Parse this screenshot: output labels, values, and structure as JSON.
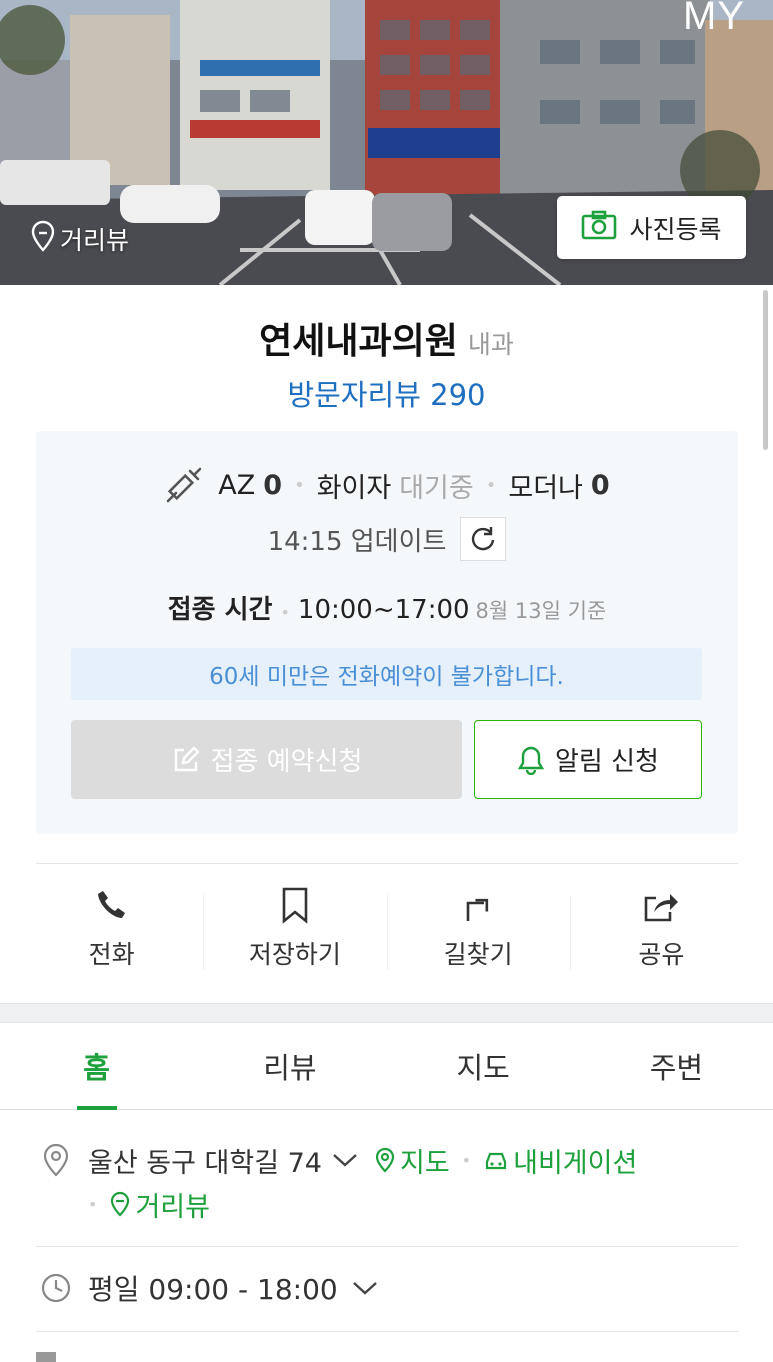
{
  "header": {
    "my_label": "MY",
    "street_view_label": "거리뷰",
    "photo_register_label": "사진등록"
  },
  "place": {
    "name": "연세내과의원",
    "category": "내과",
    "visitor_review": "방문자리뷰 290"
  },
  "vaccine": {
    "az_label": "AZ",
    "az_count": "0",
    "pfizer_label": "화이자",
    "pfizer_status": "대기중",
    "moderna_label": "모더나",
    "moderna_count": "0",
    "update_text": "14:15 업데이트",
    "time_label": "접종 시간",
    "time_value": "10:00~17:00",
    "time_basis": "8월 13일 기준",
    "notice": "60세 미만은 전화예약이 불가합니다.",
    "reserve_button": "접종 예약신청",
    "alarm_button": "알림 신청"
  },
  "actions": [
    {
      "label": "전화",
      "icon": "phone-icon"
    },
    {
      "label": "저장하기",
      "icon": "bookmark-icon"
    },
    {
      "label": "길찾기",
      "icon": "directions-icon"
    },
    {
      "label": "공유",
      "icon": "share-icon"
    }
  ],
  "tabs": [
    {
      "label": "홈",
      "active": true
    },
    {
      "label": "리뷰",
      "active": false
    },
    {
      "label": "지도",
      "active": false
    },
    {
      "label": "주변",
      "active": false
    }
  ],
  "info": {
    "address": "울산 동구 대학길 74",
    "map_link": "지도",
    "navigation_link": "내비게이션",
    "street_view_link": "거리뷰",
    "hours": "평일 09:00 - 18:00"
  },
  "colors": {
    "accent_green": "#1ea03c",
    "link_blue": "#1e6fc0",
    "notice_blue": "#4a8fd6"
  }
}
